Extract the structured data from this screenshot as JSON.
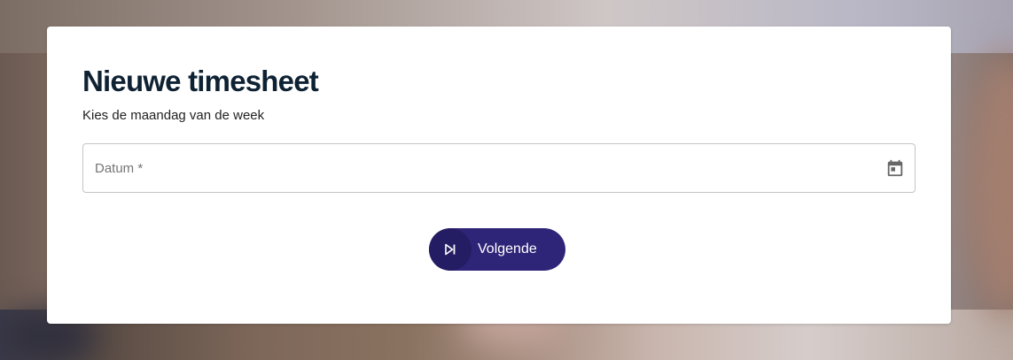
{
  "form": {
    "title": "Nieuwe timesheet",
    "subtitle": "Kies de maandag van de week",
    "date_field": {
      "placeholder": "Datum *",
      "value": "",
      "icon": "calendar-icon"
    },
    "next_button": {
      "label": "Volgende",
      "icon": "skip-next-icon"
    }
  },
  "colors": {
    "title": "#0f2233",
    "button_bg": "#2f2578",
    "button_icon_bg": "#251d63",
    "card_bg": "#ffffff",
    "field_border": "#c4c4c4"
  }
}
